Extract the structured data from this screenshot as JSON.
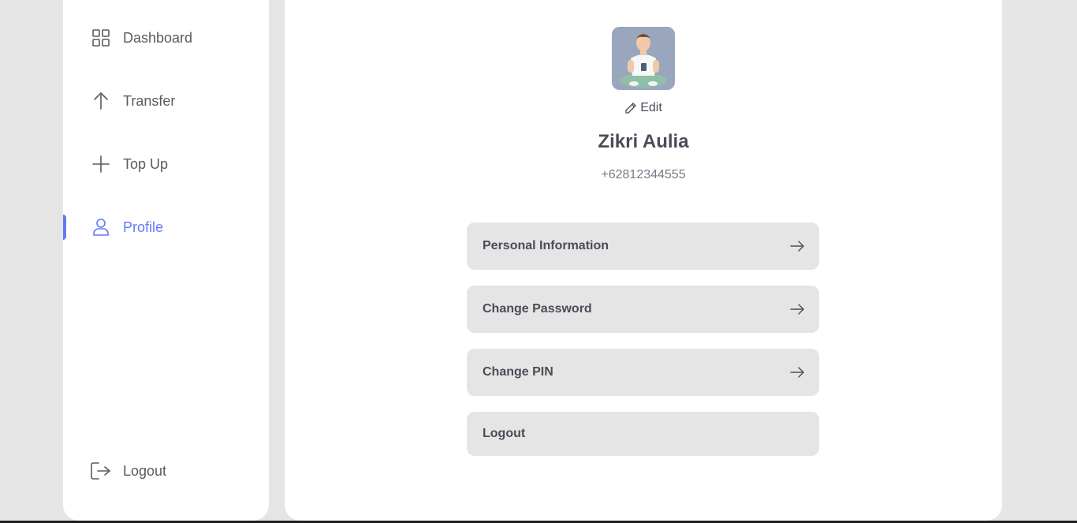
{
  "sidebar": {
    "items": [
      {
        "label": "Dashboard",
        "icon": "grid-icon"
      },
      {
        "label": "Transfer",
        "icon": "arrow-up-icon"
      },
      {
        "label": "Top Up",
        "icon": "plus-icon"
      },
      {
        "label": "Profile",
        "icon": "user-icon",
        "active": true
      }
    ],
    "logout": {
      "label": "Logout",
      "icon": "logout-icon"
    }
  },
  "profile": {
    "edit_label": "Edit",
    "name": "Zikri Aulia",
    "phone": "+62812344555"
  },
  "menu": [
    {
      "label": "Personal Information",
      "arrow": true
    },
    {
      "label": "Change Password",
      "arrow": true
    },
    {
      "label": "Change PIN",
      "arrow": true
    },
    {
      "label": "Logout",
      "arrow": false
    }
  ],
  "colors": {
    "accent": "#6379f4",
    "background": "#e5e5e5",
    "text_dark": "#4d4b57",
    "text_muted": "#7a7886"
  }
}
